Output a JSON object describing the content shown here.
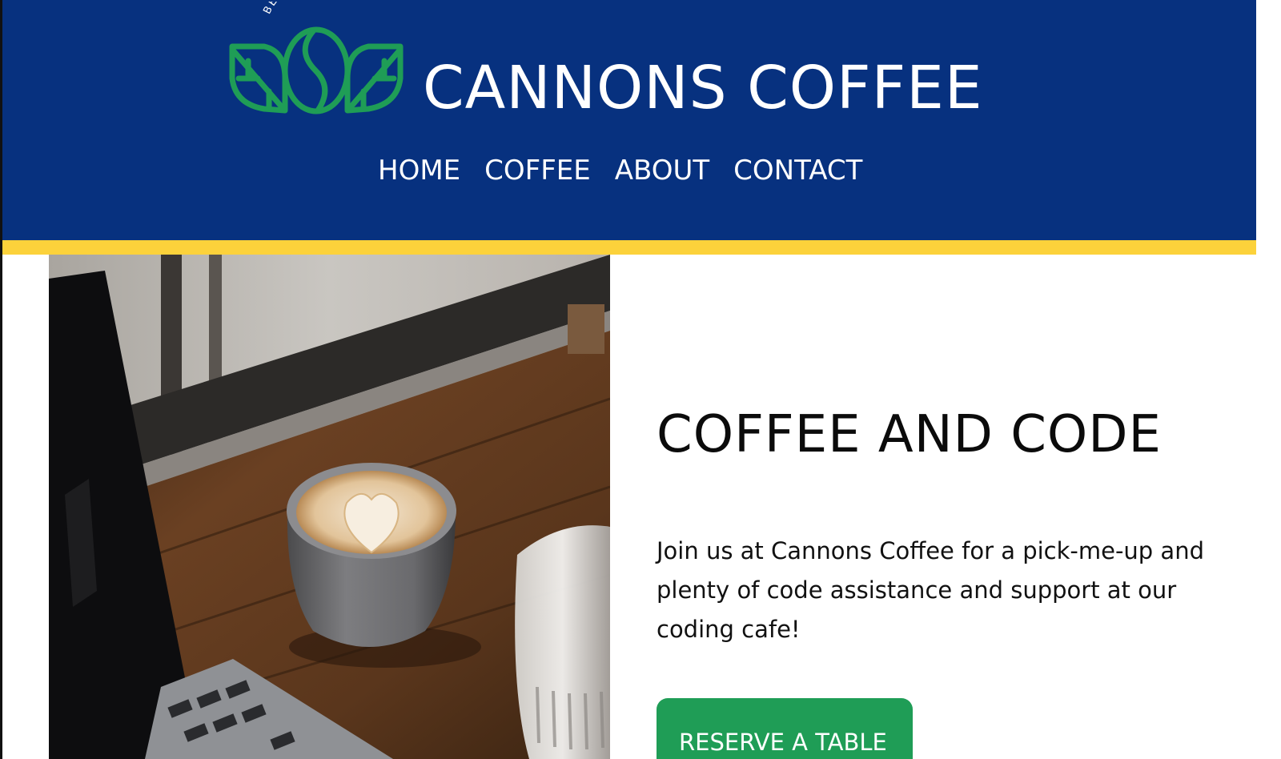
{
  "header": {
    "logo_ring_text": "BEANS OF JOY",
    "brand_name": "CANNONS COFFEE",
    "nav": [
      {
        "label": "HOME"
      },
      {
        "label": "COFFEE"
      },
      {
        "label": "ABOUT"
      },
      {
        "label": "CONTACT"
      }
    ]
  },
  "hero": {
    "image_alt": "Latte with heart art on a wooden table next to a laptop and a glass of water",
    "heading": "COFFEE AND CODE",
    "text": "Join us at Cannons Coffee for a pick-me-up and plenty of code assistance and support at our coding cafe!",
    "cta_label": "RESERVE A TABLE"
  },
  "colors": {
    "header_bg": "#07317f",
    "stripe": "#fcd23b",
    "logo_green": "#1f9d56",
    "button_bg": "#1f9d56",
    "text_dark": "#111111"
  }
}
